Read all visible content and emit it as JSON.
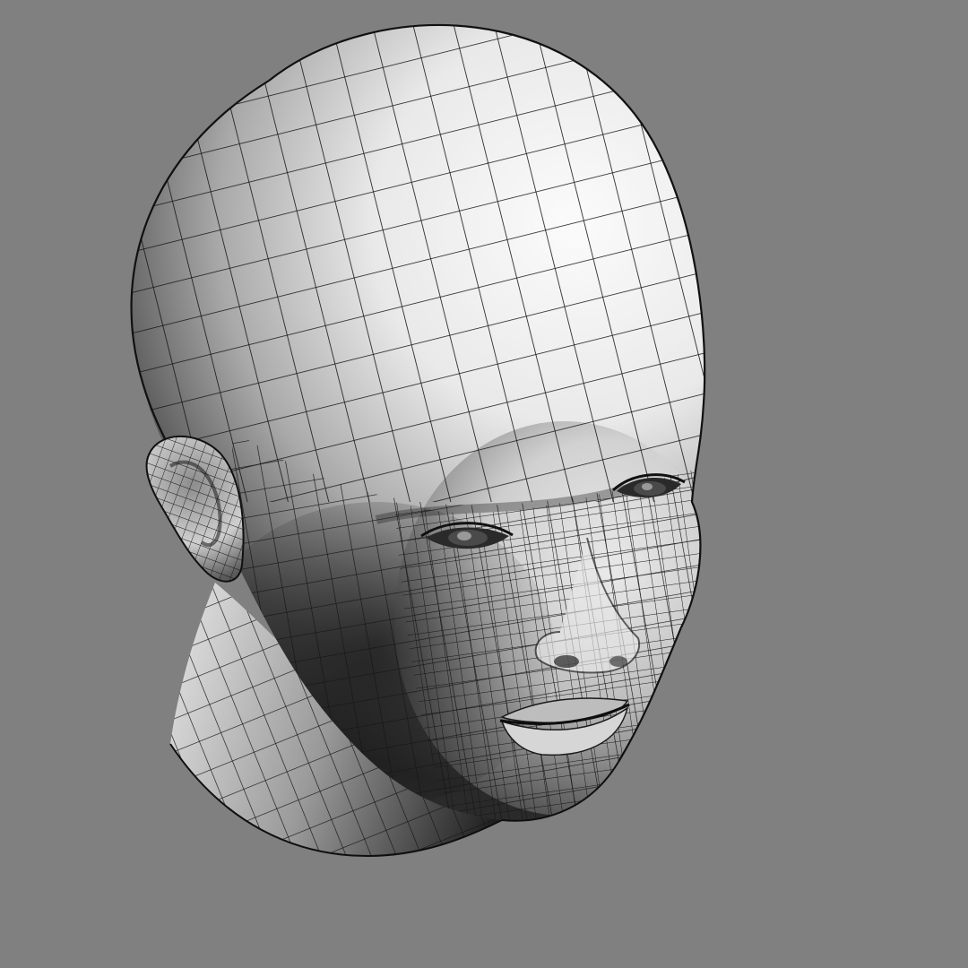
{
  "viewport": {
    "background_color": "#808080"
  },
  "model": {
    "subject": "head",
    "render_style": "wireframe-over-shaded",
    "surface_color": "#f2f2f2",
    "shadow_color": "#3a3a3a",
    "wire_color": "#141414",
    "light_direction": "top-right"
  }
}
